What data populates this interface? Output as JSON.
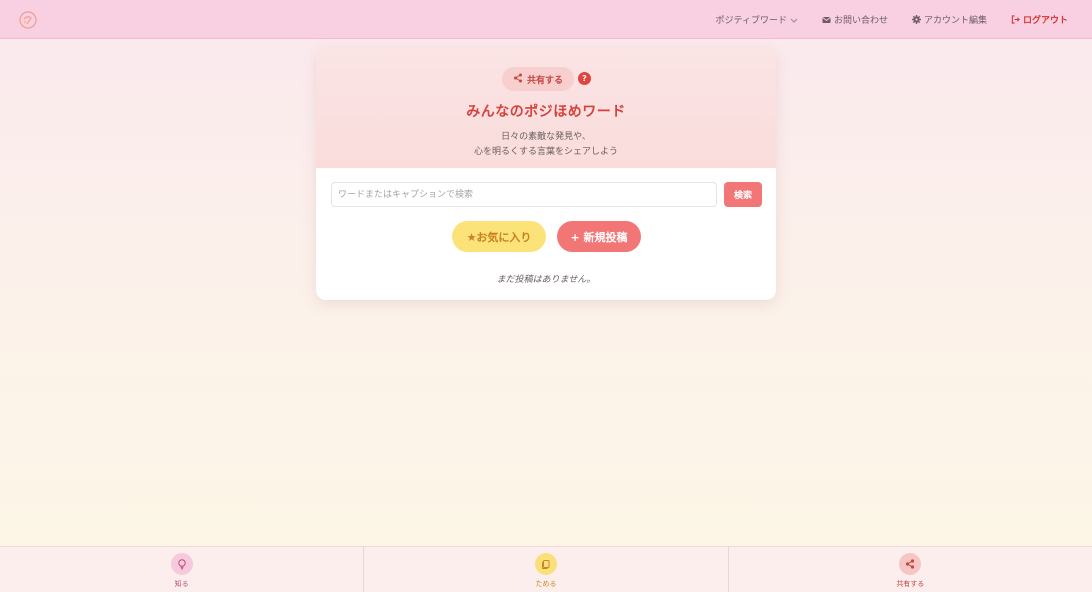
{
  "nav": {
    "items": [
      {
        "label": "ポジティブワード",
        "icon": "chevron-down-icon"
      },
      {
        "label": "お問い合わせ",
        "icon": "mail-icon"
      },
      {
        "label": "アカウント編集",
        "icon": "gear-icon"
      },
      {
        "label": "ログアウト",
        "icon": "logout-icon"
      }
    ]
  },
  "card": {
    "share_pill": "共有する",
    "help_badge": "?",
    "title": "みんなのポジほめワード",
    "subtitle_line1": "日々の素敵な発見や、",
    "subtitle_line2": "心を明るくする言葉をシェアしよう",
    "search_placeholder": "ワードまたはキャプションで検索",
    "search_value": "",
    "search_button": "検索",
    "favorite_button": "★お気に入り",
    "new_post_button": "+ 新規投稿",
    "empty_message": "まだ投稿はありません。"
  },
  "bottom_nav": [
    {
      "label": "知る",
      "icon": "lightbulb-icon"
    },
    {
      "label": "ためる",
      "icon": "copy-icon"
    },
    {
      "label": "共有する",
      "icon": "share-icon"
    }
  ],
  "colors": {
    "accent": "#f17675",
    "title": "#d6423c",
    "favorite": "#fbe37a",
    "topbar": "#f8d0e2"
  }
}
